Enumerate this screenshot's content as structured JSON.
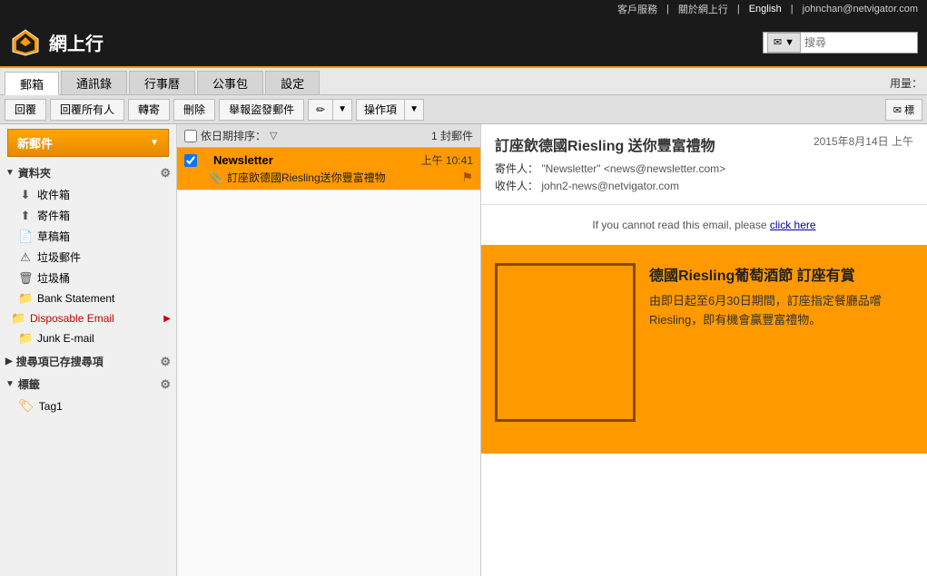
{
  "topbar": {
    "customer_service": "客戶服務",
    "about": "關於網上行",
    "language": "English",
    "email": "johnchan@netvigator.com",
    "sep1": "|",
    "sep2": "|",
    "sep3": "|"
  },
  "header": {
    "logo_text": "網上行",
    "search_placeholder": "搜尋"
  },
  "nav": {
    "tabs": [
      {
        "label": "郵箱",
        "active": true
      },
      {
        "label": "通訊錄",
        "active": false
      },
      {
        "label": "行事曆",
        "active": false
      },
      {
        "label": "公事包",
        "active": false
      },
      {
        "label": "設定",
        "active": false
      }
    ],
    "storage": "用量："
  },
  "toolbar": {
    "reply": "回覆",
    "reply_all": "回覆所有人",
    "forward": "轉寄",
    "delete": "刪除",
    "spam": "舉報盜發郵件",
    "edit_label": "✏",
    "actions": "操作項",
    "mail_icon": "✉ 標"
  },
  "sidebar": {
    "new_mail": "新郵件",
    "folders_label": "資料夾",
    "inbox": "收件箱",
    "sent": "寄件箱",
    "drafts": "草稿箱",
    "junk": "垃圾郵件",
    "trash": "垃圾桶",
    "bank_statement": "Bank Statement",
    "disposable_email": "Disposable Email",
    "junk_email": "Junk E-mail",
    "searches_label": "搜尋項已存搜尋項",
    "tags_label": "標籤",
    "tag1": "Tag1"
  },
  "message_list": {
    "sort_label": "依日期排序：",
    "sort_arrow": "▽",
    "count": "1 封郵件",
    "messages": [
      {
        "sender": "Newsletter",
        "time": "上午 10:41",
        "subject": "訂座飲德國Riesling送你豐富禮物",
        "has_dot": true,
        "has_attach": true,
        "selected": true
      }
    ]
  },
  "email": {
    "subject": "訂座飲德國Riesling 送你豐富禮物",
    "date": "2015年8月14日 上午",
    "from_label": "寄件人：",
    "from": "\"Newsletter\" <news@newsletter.com>",
    "to_label": "收件人：",
    "to": "john2-news@netvigator.com",
    "notice": "If you cannot read this email, please",
    "notice_link": "click here",
    "promo_title": "德國Riesling葡萄酒節 訂座有賞",
    "promo_body": "由即日起至6月30日期間，訂座指定餐廳品嚐Riesling，即有機會贏豐富禮物。"
  }
}
